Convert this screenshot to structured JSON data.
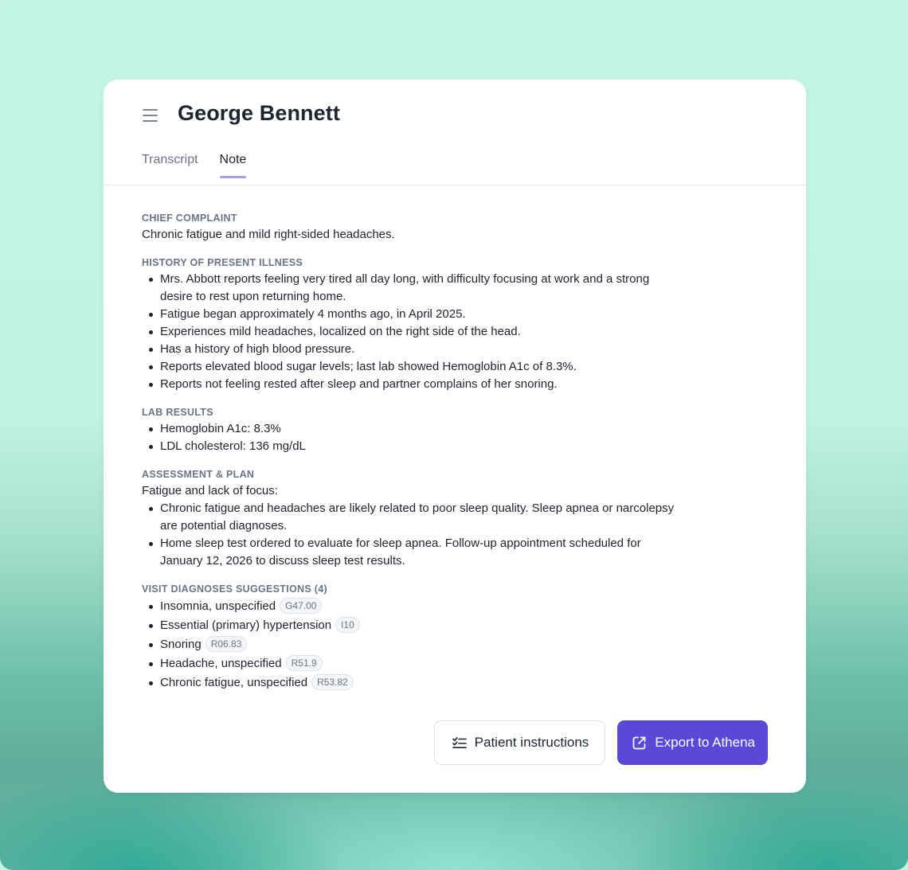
{
  "header": {
    "title": "George Bennett",
    "menu_icon": "hamburger-menu-icon",
    "tabs": [
      {
        "label": "Transcript",
        "active": false
      },
      {
        "label": "Note",
        "active": true
      }
    ]
  },
  "note": {
    "chief_complaint": {
      "title": "CHIEF COMPLAINT",
      "text": "Chronic fatigue and mild right-sided headaches."
    },
    "hpi": {
      "title": "HISTORY OF PRESENT ILLNESS",
      "items": [
        "Mrs. Abbott reports feeling very tired all day long, with difficulty focusing at work and a strong desire to rest upon returning home.",
        "Fatigue began approximately 4 months ago, in April 2025.",
        "Experiences mild headaches, localized on the right side of the head.",
        "Has a history of high blood pressure.",
        "Reports elevated blood sugar levels; last lab showed Hemoglobin A1c of 8.3%.",
        "Reports not feeling rested after sleep and partner complains of her snoring."
      ]
    },
    "lab_results": {
      "title": "LAB RESULTS",
      "items": [
        "Hemoglobin A1c: 8.3%",
        "LDL cholesterol: 136 mg/dL"
      ]
    },
    "assessment_plan": {
      "title": "ASSESSMENT & PLAN",
      "intro": "Fatigue and lack of focus:",
      "items": [
        "Chronic fatigue and headaches are likely related to poor sleep quality. Sleep apnea or narcolepsy are potential diagnoses.",
        "Home sleep test ordered to evaluate for sleep apnea. Follow-up appointment scheduled for January 12, 2026 to discuss sleep test results."
      ]
    },
    "diagnoses": {
      "title": "VISIT DIAGNOSES SUGGESTIONS (4)",
      "items": [
        {
          "label": "Insomnia, unspecified",
          "code": "G47.00"
        },
        {
          "label": "Essential (primary) hypertension",
          "code": "I10"
        },
        {
          "label": "Snoring",
          "code": "R06.83"
        },
        {
          "label": "Headache, unspecified",
          "code": "R51.9"
        },
        {
          "label": "Chronic fatigue, unspecified",
          "code": "R53.82"
        }
      ]
    }
  },
  "actions": {
    "patient_instructions": {
      "label": "Patient instructions",
      "icon": "checklist-icon"
    },
    "export": {
      "label": "Export to Athena",
      "icon": "external-link-icon"
    }
  },
  "colors": {
    "accent": "#5a48d8",
    "tab_indicator": "#a79be8",
    "background": "#c4f3e2"
  }
}
